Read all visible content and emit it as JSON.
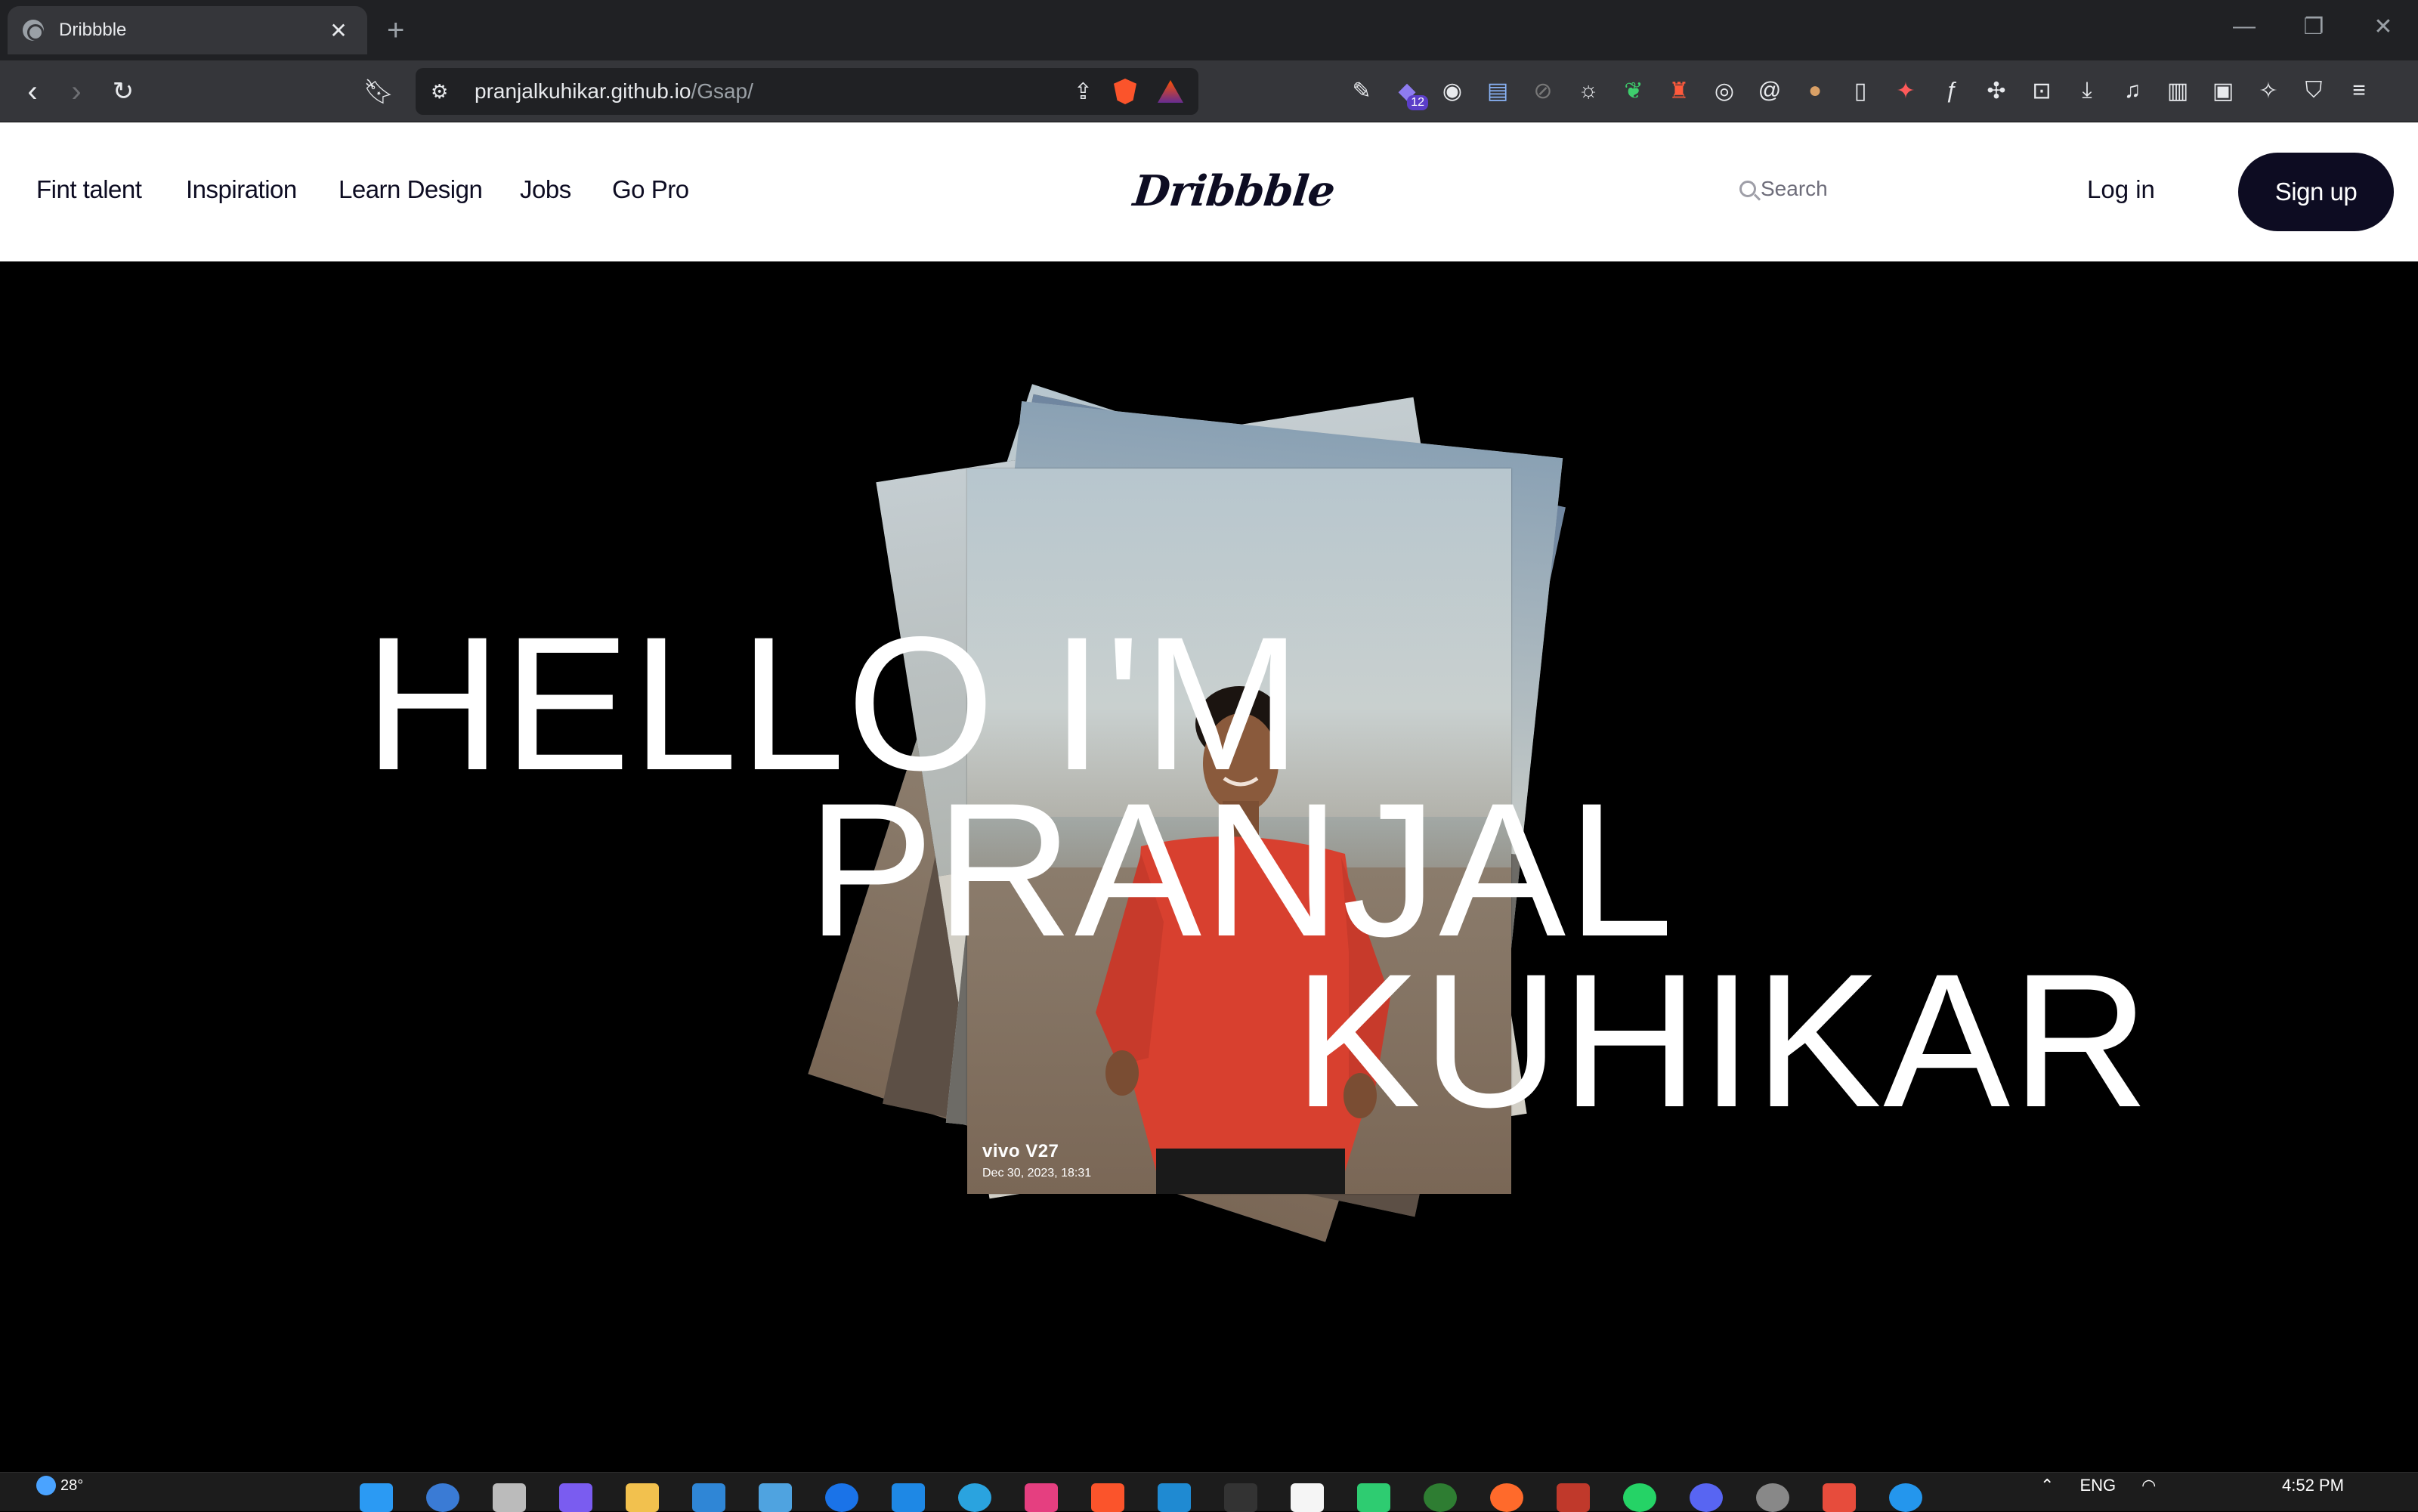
{
  "browser": {
    "tab_title": "Dribbble",
    "tab_close": "✕",
    "new_tab": "+",
    "url_host": "pranjalkuhikar.github.io",
    "url_path": "/Gsap/",
    "window_controls": [
      "—",
      "❐",
      "✕"
    ],
    "extension_badge": "12"
  },
  "site": {
    "nav": [
      "Fint talent",
      "Inspiration",
      "Learn Design",
      "Jobs",
      "Go Pro"
    ],
    "logo": "Dribbble",
    "search_placeholder": "Search",
    "login": "Log in",
    "signup": "Sign up"
  },
  "hero": {
    "line1": "HELLO I'M",
    "line2": "PRANJAL",
    "line3": "KUHIKAR",
    "photo_watermark_brand": "vivo V27",
    "photo_watermark_date": "Dec 30, 2023, 18:31"
  },
  "taskbar": {
    "temperature": "28°",
    "language": "ENG",
    "time": "4:52 PM"
  },
  "colors": {
    "brand_dark": "#0d0c22",
    "hero_bg": "#000000",
    "shirt_red": "#d8402f"
  }
}
